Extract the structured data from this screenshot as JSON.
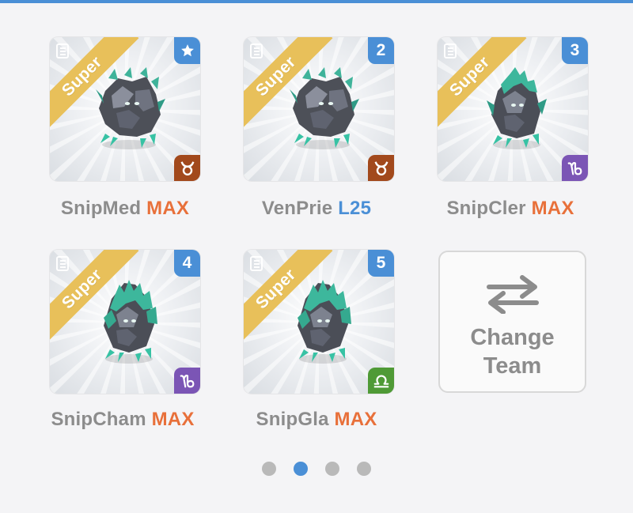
{
  "colors": {
    "accent": "#4a8fd6",
    "max": "#e8703a",
    "ribbon": "#e8c05a",
    "taurus": "#a2491c",
    "capricorn": "#7b55b5",
    "libra": "#4f9a36"
  },
  "cards": [
    {
      "ribbon": "Super",
      "badge": "",
      "badge_icon": "star-icon",
      "zodiac": "taurus",
      "name": "SnipMed",
      "level": "MAX",
      "variant": "a"
    },
    {
      "ribbon": "Super",
      "badge": "2",
      "badge_icon": "",
      "zodiac": "taurus",
      "name": "VenPrie",
      "level": "L25",
      "variant": "a"
    },
    {
      "ribbon": "Super",
      "badge": "3",
      "badge_icon": "",
      "zodiac": "capricorn",
      "name": "SnipCler",
      "level": "MAX",
      "variant": "b"
    },
    {
      "ribbon": "Super",
      "badge": "4",
      "badge_icon": "",
      "zodiac": "capricorn",
      "name": "SnipCham",
      "level": "MAX",
      "variant": "c"
    },
    {
      "ribbon": "Super",
      "badge": "5",
      "badge_icon": "",
      "zodiac": "libra",
      "name": "SnipGla",
      "level": "MAX",
      "variant": "c"
    }
  ],
  "change_team": {
    "line1": "Change",
    "line2": "Team",
    "icon": "swap-arrows-icon"
  },
  "pagination": {
    "pages": 4,
    "active_page": 2
  }
}
